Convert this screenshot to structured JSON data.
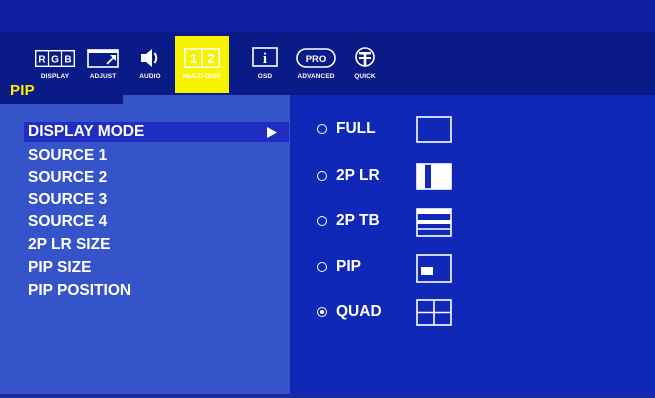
{
  "toolbar": {
    "items": [
      {
        "label": "DISPLAY",
        "icon": "rgb-display-icon",
        "rgb_letters": [
          "R",
          "G",
          "B"
        ]
      },
      {
        "label": "ADJUST",
        "icon": "adjust-icon"
      },
      {
        "label": "AUDIO",
        "icon": "speaker-icon"
      },
      {
        "label": "MULTI-DISP",
        "icon": "multi-display-icon",
        "digits": [
          "1",
          "2"
        ],
        "active": true
      },
      {
        "label": "OSD",
        "icon": "info-icon",
        "glyph": "i"
      },
      {
        "label": "ADVANCED",
        "icon": "pro-icon",
        "badge": "PRO"
      },
      {
        "label": "QUICK",
        "icon": "quick-icon"
      }
    ]
  },
  "section_title": "PIP",
  "menu": {
    "items": [
      {
        "label": "DISPLAY MODE",
        "selected": true
      },
      {
        "label": "SOURCE 1"
      },
      {
        "label": "SOURCE 2"
      },
      {
        "label": "SOURCE 3"
      },
      {
        "label": "SOURCE 4"
      },
      {
        "label": "2P LR SIZE"
      },
      {
        "label": "PIP SIZE"
      },
      {
        "label": "PIP POSITION"
      }
    ]
  },
  "options": [
    {
      "label": "FULL",
      "icon": "full-layout-icon",
      "checked": false
    },
    {
      "label": "2P LR",
      "icon": "two-panel-lr-icon",
      "checked": false
    },
    {
      "label": "2P TB",
      "icon": "two-panel-tb-icon",
      "checked": false
    },
    {
      "label": "PIP",
      "icon": "pip-layout-icon",
      "checked": false
    },
    {
      "label": "QUAD",
      "icon": "quad-layout-icon",
      "checked": true
    }
  ],
  "colors": {
    "toolbar_bg": "#0a1a86",
    "left_panel": "#3654c9",
    "right_panel": "#1028b8",
    "highlight": "#f7f200",
    "title_text": "#ffee00"
  }
}
